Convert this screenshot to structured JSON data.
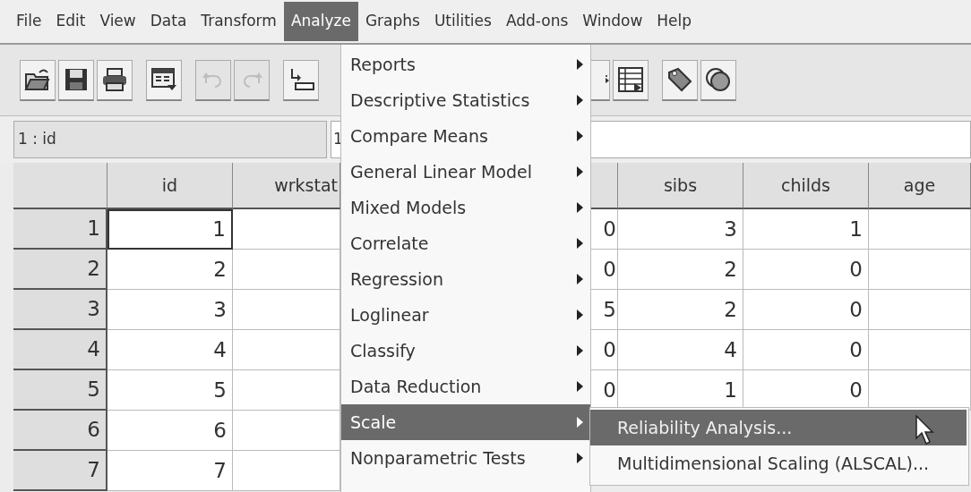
{
  "menu_bar": [
    {
      "label": "File",
      "selected": false
    },
    {
      "label": "Edit",
      "selected": false
    },
    {
      "label": "View",
      "selected": false
    },
    {
      "label": "Data",
      "selected": false
    },
    {
      "label": "Transform",
      "selected": false
    },
    {
      "label": "Analyze",
      "selected": true
    },
    {
      "label": "Graphs",
      "selected": false
    },
    {
      "label": "Utilities",
      "selected": false
    },
    {
      "label": "Add-ons",
      "selected": false
    },
    {
      "label": "Window",
      "selected": false
    },
    {
      "label": "Help",
      "selected": false
    }
  ],
  "toolbar": {
    "left": [
      {
        "disabled": false
      },
      {
        "disabled": false
      },
      {
        "disabled": false
      },
      {
        "disabled": false
      },
      {
        "disabled": true
      },
      {
        "disabled": true
      },
      {
        "disabled": false
      }
    ],
    "right": [
      {
        "disabled": false
      },
      {
        "disabled": false
      },
      {
        "disabled": false
      },
      {
        "disabled": false
      }
    ]
  },
  "cell_editor": {
    "cell_name": "1 : id",
    "value": "1"
  },
  "grid": {
    "columns": [
      "id",
      "wrkstat",
      "sibs",
      "childs",
      "age"
    ],
    "rows": [
      {
        "case": "1",
        "id": "1",
        "column_3": "0",
        "sibs": "3",
        "childs": "1",
        "selected": true
      },
      {
        "case": "2",
        "id": "2",
        "column_3": "0",
        "sibs": "2",
        "childs": "0",
        "selected": false
      },
      {
        "case": "3",
        "id": "3",
        "column_3": "5",
        "sibs": "2",
        "childs": "0",
        "selected": false
      },
      {
        "case": "4",
        "id": "4",
        "column_3": "0",
        "sibs": "4",
        "childs": "0",
        "selected": false
      },
      {
        "case": "5",
        "id": "5",
        "column_3": "0",
        "sibs": "1",
        "childs": "0",
        "selected": false
      },
      {
        "case": "6",
        "id": "6",
        "selected": false
      },
      {
        "case": "7",
        "id": "7",
        "selected": false
      }
    ]
  },
  "analyze_menu": [
    {
      "label": "Reports",
      "has_submenu": true,
      "selected": false
    },
    {
      "label": "Descriptive Statistics",
      "has_submenu": true,
      "selected": false
    },
    {
      "label": "Compare Means",
      "has_submenu": true,
      "selected": false
    },
    {
      "label": "General Linear Model",
      "has_submenu": true,
      "selected": false
    },
    {
      "label": "Mixed Models",
      "has_submenu": true,
      "selected": false
    },
    {
      "label": "Correlate",
      "has_submenu": true,
      "selected": false
    },
    {
      "label": "Regression",
      "has_submenu": true,
      "selected": false
    },
    {
      "label": "Loglinear",
      "has_submenu": true,
      "selected": false
    },
    {
      "label": "Classify",
      "has_submenu": true,
      "selected": false
    },
    {
      "label": "Data Reduction",
      "has_submenu": true,
      "selected": false
    },
    {
      "label": "Scale",
      "has_submenu": true,
      "selected": true
    },
    {
      "label": "Nonparametric Tests",
      "has_submenu": true,
      "selected": false
    }
  ],
  "scale_submenu": [
    {
      "label": "Reliability Analysis...",
      "selected": true
    },
    {
      "label": "Multidimensional Scaling (ALSCAL)...",
      "selected": false
    }
  ]
}
